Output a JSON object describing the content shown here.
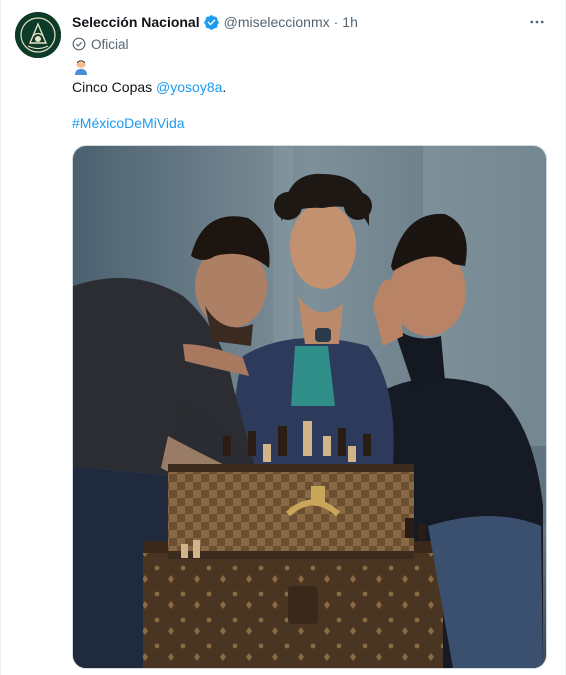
{
  "tweet": {
    "display_name": "Selección Nacional",
    "handle": "@miseleccionmx",
    "separator": "·",
    "time": "1h",
    "badge_label": "Oficial",
    "text_before": "Cinco Copas ",
    "mention": "@yosoy8a",
    "text_after": ".",
    "hashtag": "#MéxicoDeMiVida"
  },
  "icons": {
    "verified": "verified-badge-icon",
    "more": "more-dots-icon",
    "official": "official-check-icon",
    "emoji": "man-facepalm-emoji-icon"
  },
  "colors": {
    "accent": "#1d9bf0",
    "text": "#0f1419",
    "muted": "#536471",
    "avatar_bg": "#0d3b2a"
  }
}
